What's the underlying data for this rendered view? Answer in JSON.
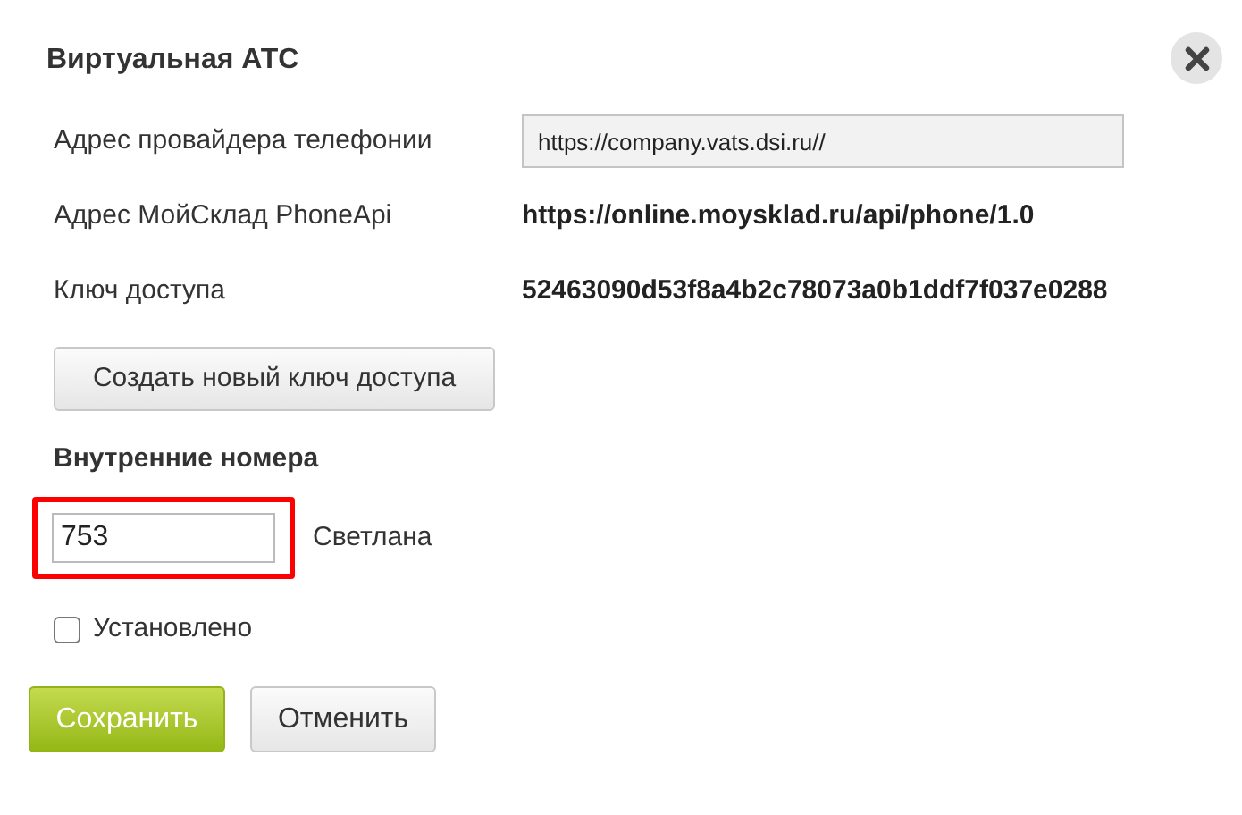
{
  "dialog": {
    "title": "Виртуальная АТС"
  },
  "fields": [
    {
      "kind": "input",
      "label": "Адрес провайдера телефонии",
      "value": "https://company.vats.dsi.ru//"
    },
    {
      "kind": "text",
      "label": "Адрес МойСклад PhoneApi",
      "value": "https://online.moysklad.ru/api/phone/1.0"
    },
    {
      "kind": "text",
      "label": "Ключ доступа",
      "value": "52463090d53f8a4b2c78073a0b1ddf7f037e0288"
    }
  ],
  "generate_key_button": "Создать новый ключ доступа",
  "extensions": {
    "heading": "Внутренние номера",
    "rows": [
      {
        "number": "753",
        "name": "Светлана",
        "highlighted": true
      }
    ]
  },
  "installed": {
    "label": "Установлено",
    "checked": false
  },
  "buttons": [
    {
      "kind": "primary",
      "label": "Сохранить"
    },
    {
      "kind": "secondary",
      "label": "Отменить"
    }
  ]
}
